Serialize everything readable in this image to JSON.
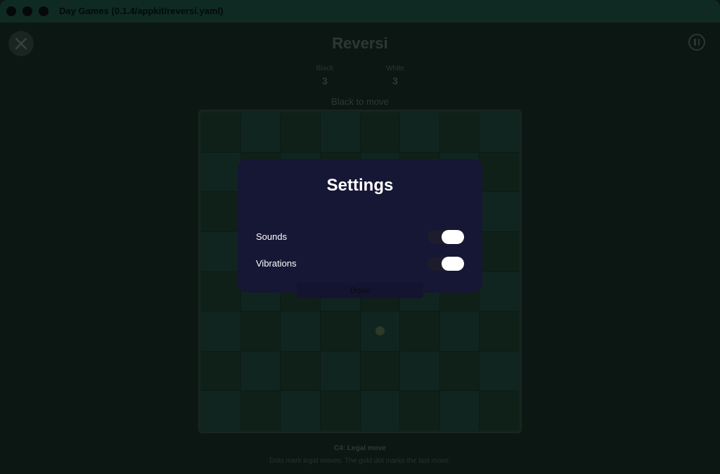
{
  "window": {
    "title": "Day Games (0.1.4/appkit/reversi.yaml)"
  },
  "game": {
    "title": "Reversi",
    "scores": {
      "black_label": "Black",
      "black_value": "3",
      "white_label": "White",
      "white_value": "3"
    },
    "turn": "Black to move",
    "status": "C4: Legal move",
    "hint": "Dots mark legal moves. The gold dot marks the last move."
  },
  "board": {
    "size": 8,
    "legal_move_dots": [
      "E6"
    ]
  },
  "settings_modal": {
    "title": "Settings",
    "sounds_label": "Sounds",
    "sounds_on": true,
    "vibrations_label": "Vibrations",
    "vibrations_on": true,
    "done_label": "Done"
  },
  "icons": {
    "close": "close-icon",
    "pause": "pause-icon"
  },
  "colors": {
    "background": "#0c1714",
    "modal": "#161635",
    "titlebar": "#0f2a22"
  }
}
